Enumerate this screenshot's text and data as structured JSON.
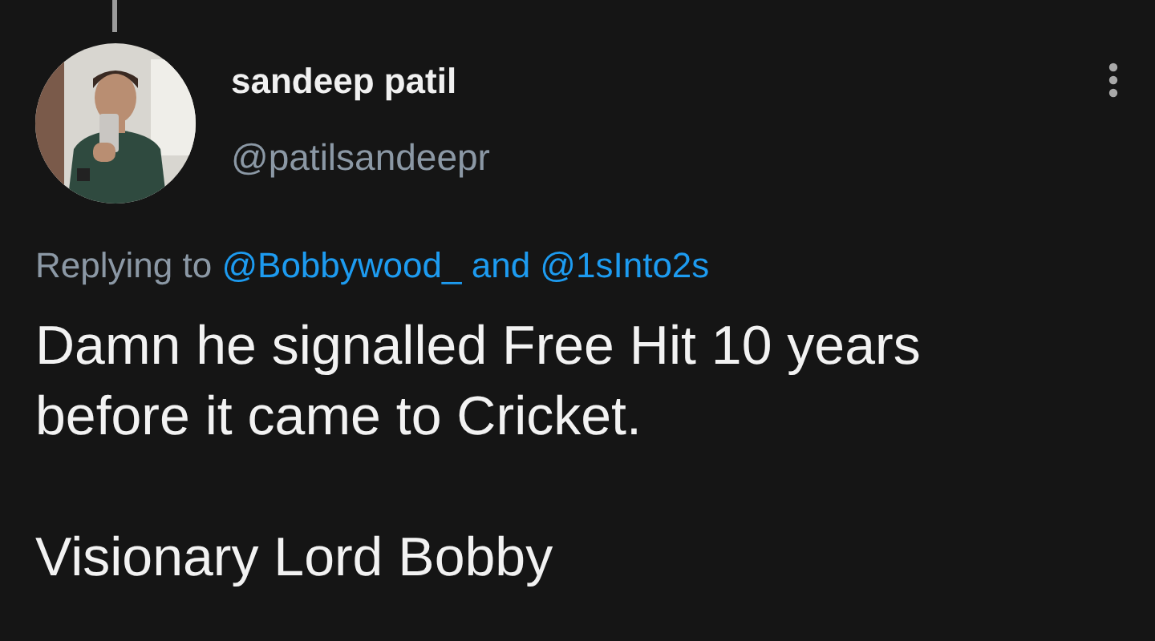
{
  "tweet": {
    "author": {
      "name": "sandeep patil",
      "handle": "@patilsandeepr"
    },
    "thread_line": true,
    "replying_to": {
      "label": "Replying to",
      "mentions": [
        "@Bobbywood_",
        "@1sInto2s"
      ],
      "joiner": "and"
    },
    "paragraphs": [
      "Damn he signalled Free Hit 10 years before it came to Cricket.",
      "Visionary Lord Bobby"
    ]
  }
}
